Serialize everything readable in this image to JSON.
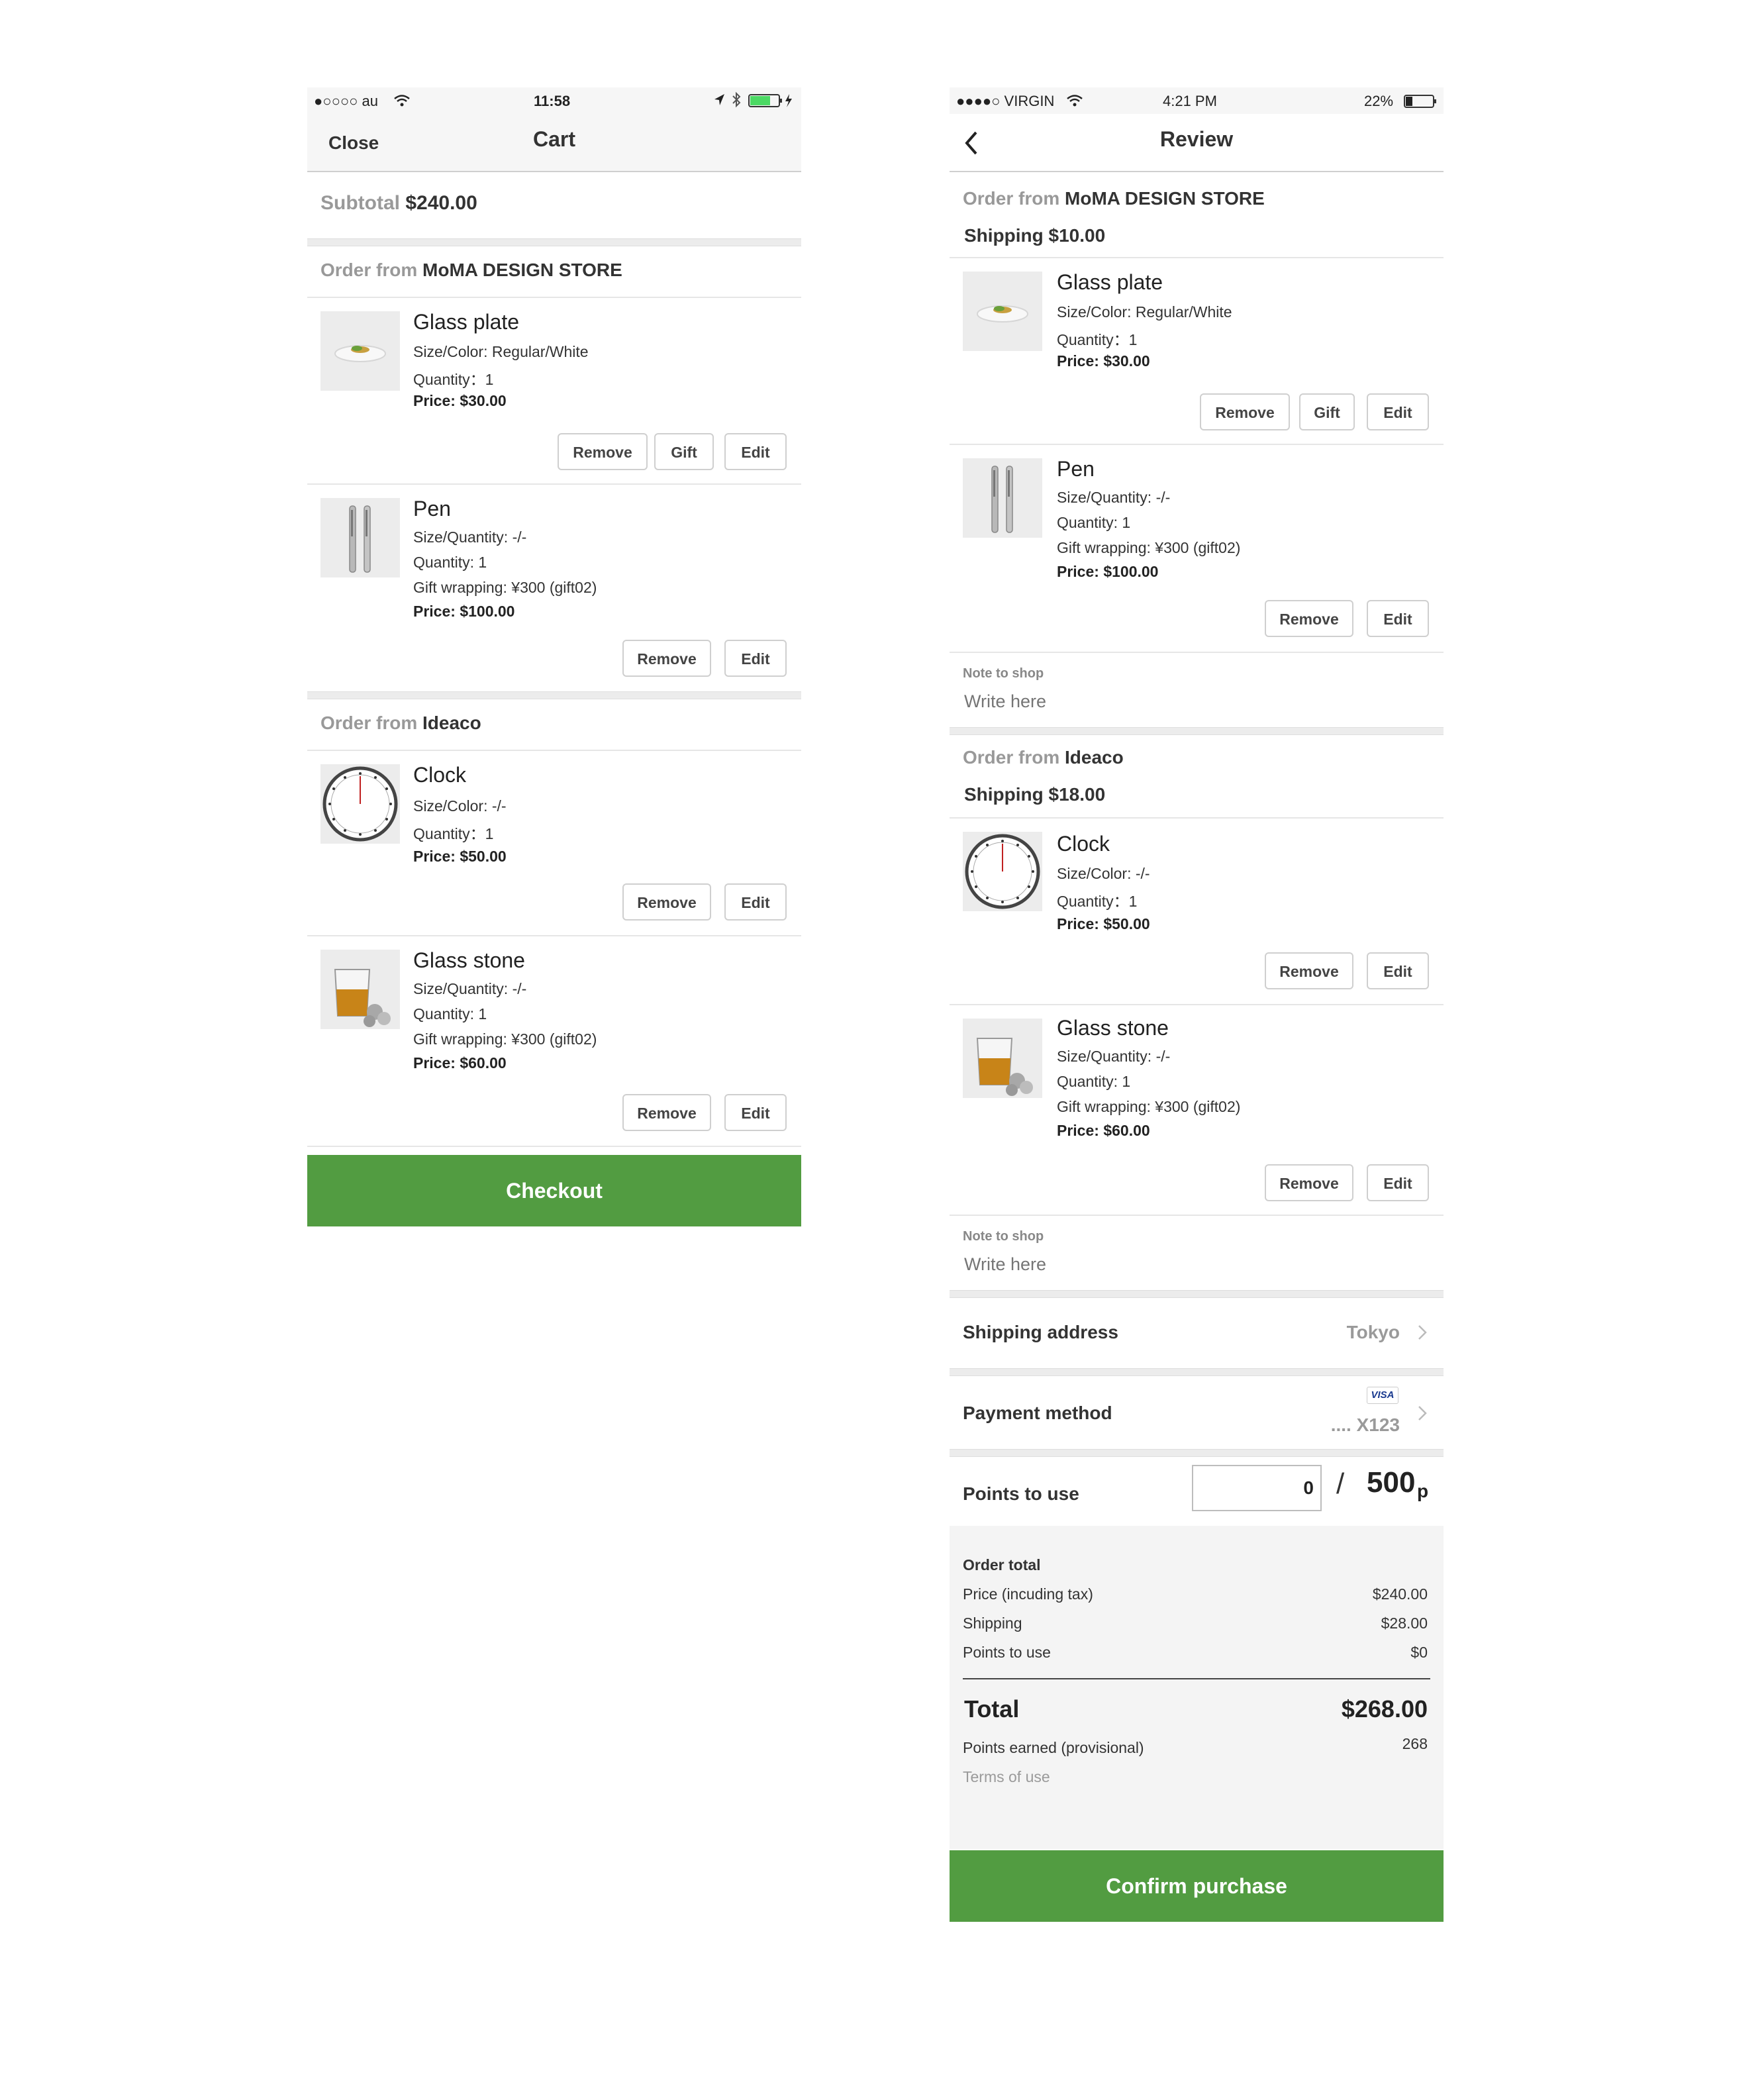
{
  "cart_screen": {
    "status": {
      "carrier": "●○○○○ au",
      "time": "11:58"
    },
    "nav": {
      "close": "Close",
      "title": "Cart"
    },
    "subtotal": {
      "label": "Subtotal",
      "value": "$240.00"
    },
    "stores": [
      {
        "prefix": "Order from",
        "name": "MoMA DESIGN STORE",
        "items": [
          {
            "name": "Glass plate",
            "lines": [
              "Size/Color: Regular/White",
              "Quantity：1"
            ],
            "price": "Price:  $30.00",
            "buttons": [
              "Remove",
              "Gift",
              "Edit"
            ]
          },
          {
            "name": "Pen",
            "lines": [
              "Size/Quantity: -/-",
              "Quantity: 1",
              "Gift wrapping: ¥300 (gift02)"
            ],
            "price": "Price: $100.00",
            "buttons": [
              "Remove",
              "Edit"
            ]
          }
        ]
      },
      {
        "prefix": "Order from",
        "name": "Ideaco",
        "items": [
          {
            "name": "Clock",
            "lines": [
              "Size/Color: -/-",
              "Quantity：1"
            ],
            "price": "Price:  $50.00",
            "buttons": [
              "Remove",
              "Edit"
            ]
          },
          {
            "name": "Glass stone",
            "lines": [
              "Size/Quantity: -/-",
              "Quantity: 1",
              "Gift wrapping: ¥300 (gift02)"
            ],
            "price": "Price: $60.00",
            "buttons": [
              "Remove",
              "Edit"
            ]
          }
        ]
      }
    ],
    "checkout": "Checkout"
  },
  "review_screen": {
    "status": {
      "carrier": "●●●●○ VIRGIN",
      "time": "4:21 PM",
      "battery": "22%"
    },
    "nav": {
      "title": "Review"
    },
    "stores": [
      {
        "prefix": "Order from",
        "name": "MoMA DESIGN STORE",
        "shipping": "Shipping $10.00",
        "items": [
          {
            "name": "Glass plate",
            "lines": [
              "Size/Color: Regular/White",
              "Quantity：1"
            ],
            "price": "Price:  $30.00",
            "buttons": [
              "Remove",
              "Gift",
              "Edit"
            ]
          },
          {
            "name": "Pen",
            "lines": [
              "Size/Quantity: -/-",
              "Quantity: 1",
              "Gift wrapping: ¥300 (gift02)"
            ],
            "price": "Price: $100.00",
            "buttons": [
              "Remove",
              "Edit"
            ]
          }
        ],
        "note_label": "Note to shop",
        "note_placeholder": "Write here"
      },
      {
        "prefix": "Order from",
        "name": "Ideaco",
        "shipping": "Shipping $18.00",
        "items": [
          {
            "name": "Clock",
            "lines": [
              "Size/Color: -/-",
              "Quantity：1"
            ],
            "price": "Price:  $50.00",
            "buttons": [
              "Remove",
              "Edit"
            ]
          },
          {
            "name": "Glass stone",
            "lines": [
              "Size/Quantity: -/-",
              "Quantity: 1",
              "Gift wrapping: ¥300 (gift02)"
            ],
            "price": "Price: $60.00",
            "buttons": [
              "Remove",
              "Edit"
            ]
          }
        ],
        "note_label": "Note to shop",
        "note_placeholder": "Write here"
      }
    ],
    "shipping_address": {
      "label": "Shipping address",
      "value": "Tokyo"
    },
    "payment": {
      "label": "Payment method",
      "card_brand": "VISA",
      "card_number": ".... X123"
    },
    "points": {
      "label": "Points to use",
      "value": "0",
      "slash": "/",
      "max": "500",
      "unit": "p"
    },
    "order_total": {
      "heading": "Order total",
      "lines": [
        {
          "label": "Price (incuding tax)",
          "value": "$240.00"
        },
        {
          "label": "Shipping",
          "value": "$28.00"
        },
        {
          "label": "Points to use",
          "value": "$0"
        }
      ],
      "total_label": "Total",
      "total_value": "$268.00",
      "points_earned_label": "Points earned (provisional)",
      "points_earned_value": "268",
      "terms": "Terms of use"
    },
    "confirm": "Confirm purchase"
  },
  "colors": {
    "accent_green": "#529c41",
    "muted_text": "#999999",
    "background_gray": "#f4f4f4"
  }
}
